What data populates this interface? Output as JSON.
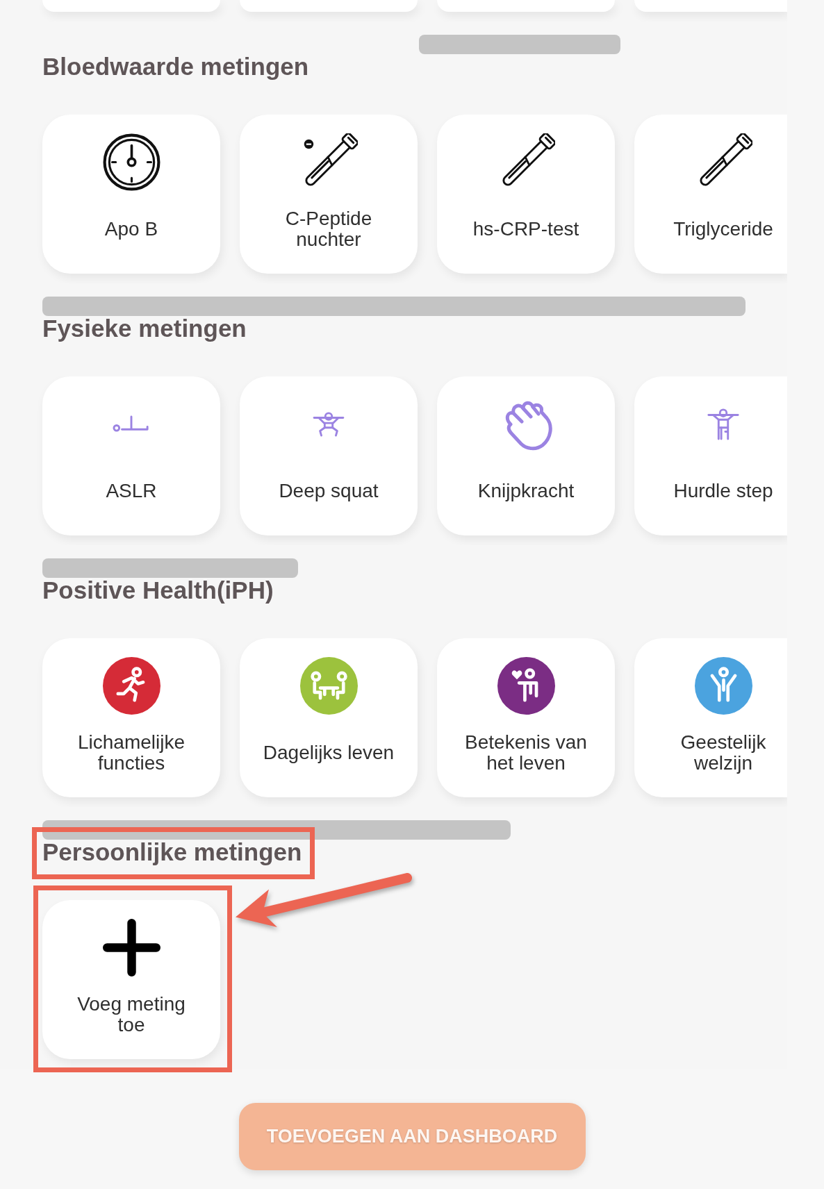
{
  "previous_row": [
    {
      "kind": "tile"
    },
    {
      "kind": "tile"
    },
    {
      "kind": "tile"
    },
    {
      "kind": "tile"
    }
  ],
  "sections": [
    {
      "title": "Bloedwaarde metingen",
      "highlighted": false,
      "tiles": [
        {
          "label": "Apo B",
          "highlighted": false
        },
        {
          "label": "C-Peptide nuchter",
          "highlighted": false
        },
        {
          "label": "hs-CRP-test",
          "highlighted": false
        },
        {
          "label": "Triglyceride",
          "highlighted": false
        }
      ]
    },
    {
      "title": "Fysieke metingen",
      "highlighted": false,
      "tiles": [
        {
          "label": "ASLR",
          "highlighted": false
        },
        {
          "label": "Deep squat",
          "highlighted": false
        },
        {
          "label": "Knijpkracht",
          "highlighted": false
        },
        {
          "label": "Hurdle step",
          "highlighted": false
        }
      ]
    },
    {
      "title": "Positive Health(iPH)",
      "highlighted": false,
      "tiles": [
        {
          "label": "Lichamelijke functies",
          "highlighted": false,
          "color": "#d52b37"
        },
        {
          "label": "Dagelijks leven",
          "highlighted": false,
          "color": "#9cc23d"
        },
        {
          "label": "Betekenis van het leven",
          "highlighted": false,
          "color": "#7b2d84"
        },
        {
          "label": "Geestelijk welzijn",
          "highlighted": false,
          "color": "#4ba3df"
        }
      ]
    },
    {
      "title": "Persoonlijke metingen",
      "highlighted": true,
      "tiles": [
        {
          "label": "Voeg meting toe",
          "highlighted": true
        }
      ]
    }
  ],
  "primary_button": {
    "label": "TOEVOEGEN AAN DASHBOARD",
    "disabled": true
  }
}
